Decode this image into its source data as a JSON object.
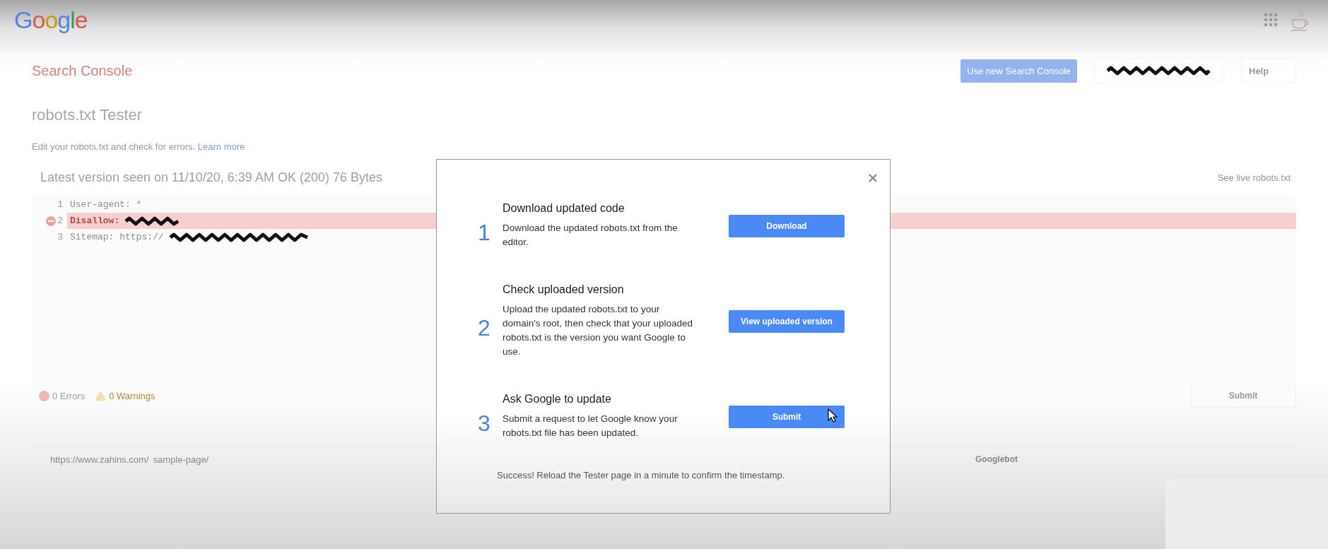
{
  "header": {
    "logo": "Google",
    "product": "Search Console",
    "new_console_button": "Use new Search Console",
    "account_redacted": true,
    "help": "Help"
  },
  "page": {
    "title": "robots.txt Tester",
    "description": "Edit your robots.txt and check for errors.",
    "learn_more": "Learn more",
    "version": "Latest version seen on 11/10/20, 6:39 AM OK (200) 76 Bytes",
    "live_link": "See live robots.txt"
  },
  "editor": {
    "lines": [
      {
        "number": "1",
        "text": "User-agent: *",
        "error": false,
        "redacted": false
      },
      {
        "number": "2",
        "text": "Disallow:",
        "error": true,
        "redacted": true
      },
      {
        "number": "3",
        "text": "Sitemap: https://",
        "error": false,
        "redacted": true
      }
    ]
  },
  "status": {
    "errors": "0 Errors",
    "warnings": "0 Warnings"
  },
  "submit_button": "Submit",
  "url_bar": {
    "prefix": "https://www.zahins.com/",
    "value": "sample-page/",
    "agent": "Googlebot"
  },
  "dialog": {
    "steps": [
      {
        "number": "1",
        "title": "Download updated code",
        "text": "Download the updated robots.txt from the editor.",
        "button": "Download",
        "cursor": false
      },
      {
        "number": "2",
        "title": "Check uploaded version",
        "text": "Upload the updated robots.txt to your domain's root, then check that your uploaded robots.txt is the version you want Google to use.",
        "button": "View uploaded version",
        "cursor": false
      },
      {
        "number": "3",
        "title": "Ask Google to update",
        "text": "Submit a request to let Google know your robots.txt file has been updated.",
        "button": "Submit",
        "cursor": true
      }
    ],
    "message": "Success! Reload the Tester page in a minute to confirm the timestamp."
  }
}
